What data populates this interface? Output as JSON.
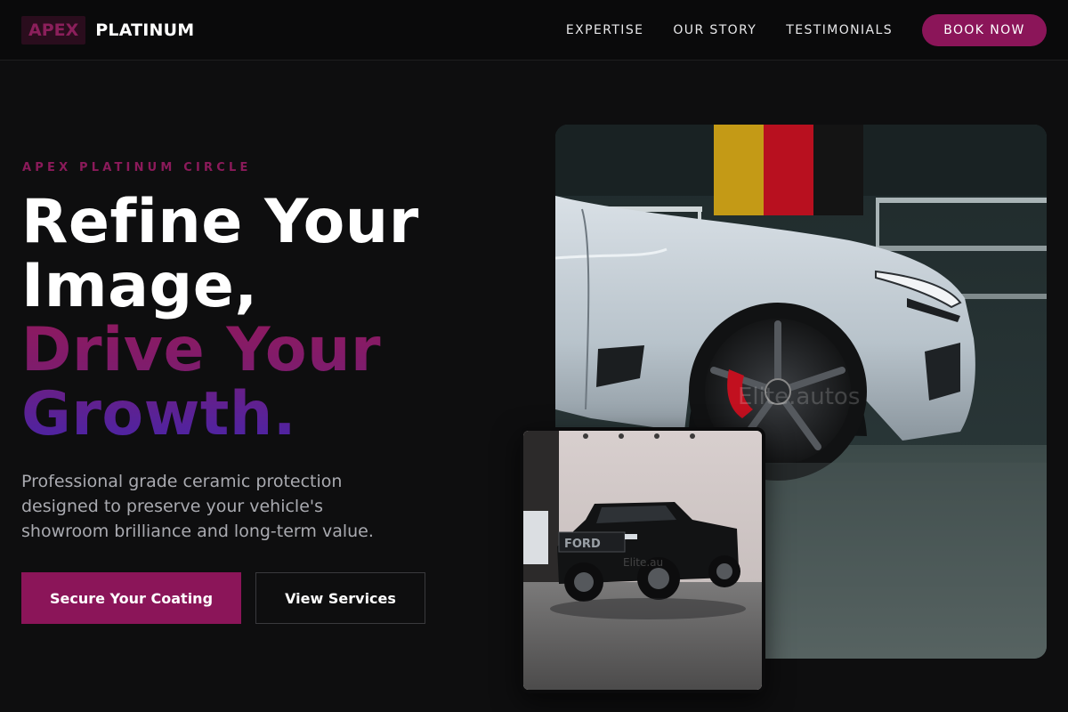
{
  "brand": {
    "badge": "APEX",
    "name": "PLATINUM"
  },
  "nav": {
    "links": [
      "EXPERTISE",
      "OUR STORY",
      "TESTIMONIALS"
    ],
    "cta": "BOOK NOW"
  },
  "hero": {
    "eyebrow": "APEX PLATINUM CIRCLE",
    "headline_lines": [
      "Refine Your",
      "Image,",
      "Drive Your",
      "Growth."
    ],
    "lead": "Professional grade ceramic protection designed to preserve your vehicle's showroom brilliance and long-term value.",
    "primary_cta": "Secure Your Coating",
    "secondary_cta": "View Services"
  },
  "images": {
    "main_watermark": "Elite.autos",
    "inset_watermark": "Elite.au",
    "inset_plate": "FORD"
  },
  "colors": {
    "accent": "#8b1559",
    "gradient_start": "#8e1a5f",
    "gradient_end": "#4a24a6",
    "background": "#0e0e0f"
  }
}
